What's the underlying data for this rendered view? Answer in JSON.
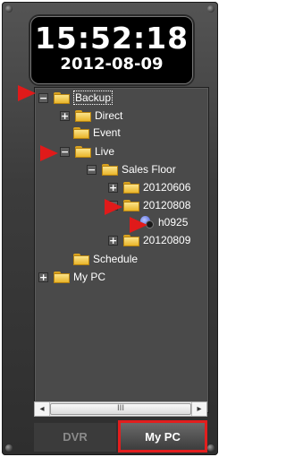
{
  "clock": {
    "time": "15:52:18",
    "date": "2012-08-09"
  },
  "tree": {
    "backup": {
      "label": "Backup",
      "expander": "−"
    },
    "direct": {
      "label": "Direct",
      "expander": "+"
    },
    "event": {
      "label": "Event"
    },
    "live": {
      "label": "Live",
      "expander": "−"
    },
    "sales_floor": {
      "label": "Sales Floor",
      "expander": "−"
    },
    "d20120606": {
      "label": "20120606",
      "expander": "+"
    },
    "d20120808": {
      "label": "20120808",
      "expander": "−"
    },
    "h0925": {
      "label": "h0925"
    },
    "d20120809": {
      "label": "20120809",
      "expander": "+"
    },
    "schedule": {
      "label": "Schedule"
    },
    "mypc": {
      "label": "My PC",
      "expander": "+"
    }
  },
  "scrollbar": {
    "left": "◂",
    "right": "▸",
    "grip": "III"
  },
  "tabs": {
    "dvr": "DVR",
    "mypc": "My PC"
  },
  "colors": {
    "highlight": "#e01a1a",
    "folder": "#f2c23f",
    "panel": "#3c3c3c"
  }
}
